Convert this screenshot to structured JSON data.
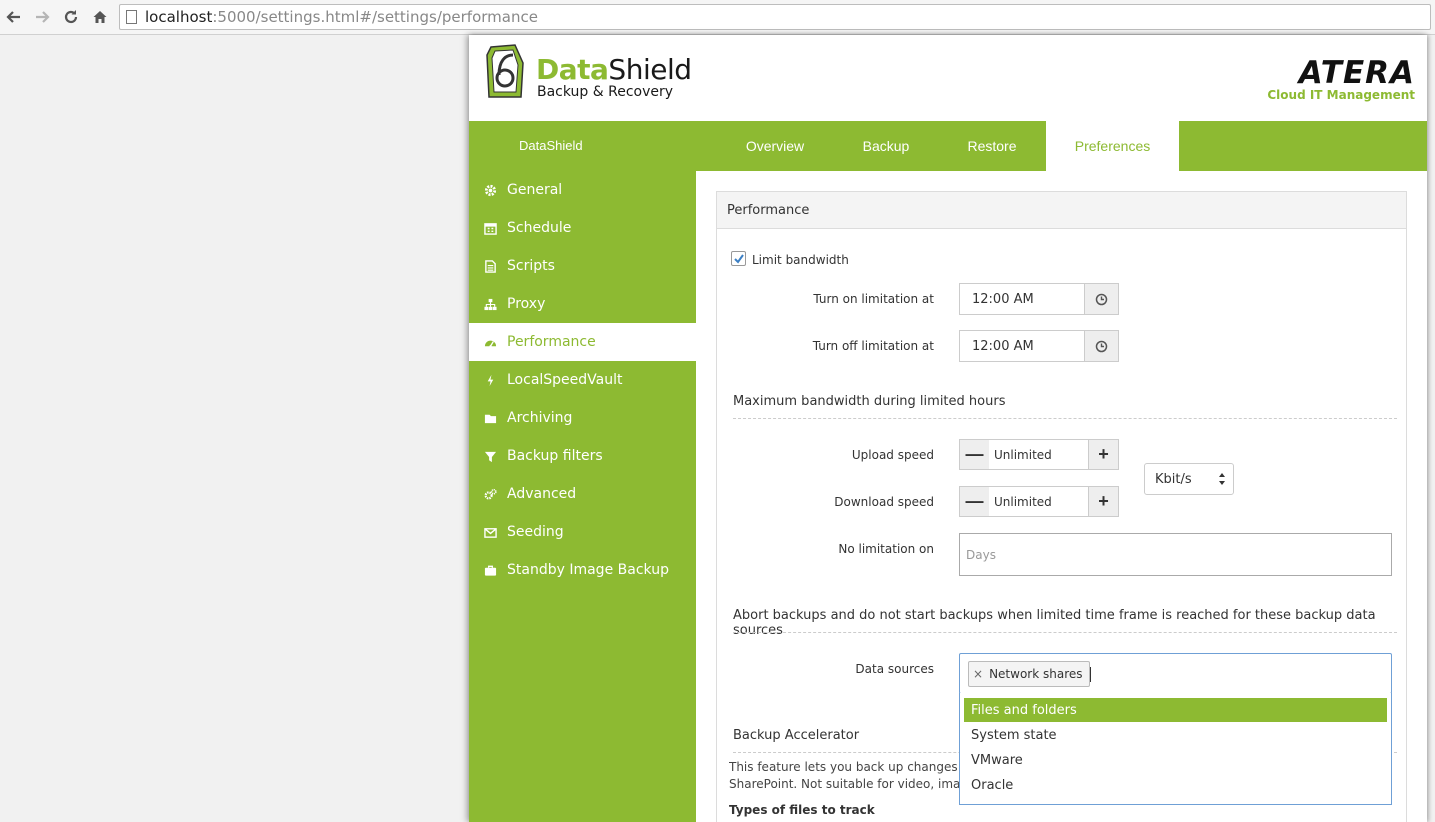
{
  "browser": {
    "url_host": "localhost",
    "url_path": ":5000/settings.html#/settings/performance"
  },
  "header": {
    "brand_green": "Data",
    "brand_dark": "Shield",
    "brand_sub": "Backup & Recovery",
    "partner_logo": "ATERA",
    "partner_sub": "Cloud IT Management"
  },
  "top_nav": {
    "brand": "DataShield",
    "tabs": [
      {
        "label": "Overview"
      },
      {
        "label": "Backup"
      },
      {
        "label": "Restore"
      },
      {
        "label": "Preferences"
      }
    ],
    "active_tab": "Preferences"
  },
  "sidebar": {
    "items": [
      {
        "label": "General",
        "icon": "gear-icon"
      },
      {
        "label": "Schedule",
        "icon": "calendar-icon"
      },
      {
        "label": "Scripts",
        "icon": "document-icon"
      },
      {
        "label": "Proxy",
        "icon": "sitemap-icon"
      },
      {
        "label": "Performance",
        "icon": "dashboard-icon"
      },
      {
        "label": "LocalSpeedVault",
        "icon": "bolt-icon"
      },
      {
        "label": "Archiving",
        "icon": "folder-icon"
      },
      {
        "label": "Backup filters",
        "icon": "filter-icon"
      },
      {
        "label": "Advanced",
        "icon": "gears-icon"
      },
      {
        "label": "Seeding",
        "icon": "envelope-icon"
      },
      {
        "label": "Standby Image Backup",
        "icon": "briefcase-icon"
      }
    ],
    "active": "Performance"
  },
  "panel": {
    "title": "Performance",
    "limit_bandwidth": {
      "label": "Limit bandwidth",
      "checked": true
    },
    "turn_on": {
      "label": "Turn on limitation at",
      "value": "12:00 AM"
    },
    "turn_off": {
      "label": "Turn off limitation at",
      "value": "12:00 AM"
    },
    "max_bandwidth_title": "Maximum bandwidth during limited hours",
    "upload": {
      "label": "Upload speed",
      "value": "Unlimited"
    },
    "download": {
      "label": "Download speed",
      "value": "Unlimited"
    },
    "unit": {
      "selected": "Kbit/s"
    },
    "no_limitation": {
      "label": "No limitation on",
      "placeholder": "Days"
    },
    "abort_title": "Abort backups and do not start backups when limited time frame is reached for these backup data sources",
    "data_sources": {
      "label": "Data sources",
      "selected_tags": [
        "Network shares"
      ],
      "options": [
        "Files and folders",
        "System state",
        "VMware",
        "Oracle"
      ],
      "highlighted": "Files and folders"
    },
    "accelerator_title": "Backup Accelerator",
    "accelerator_text_1": "This feature lets you back up changes wit",
    "accelerator_text_2": "SharePoint. Not suitable for video, image",
    "types_title": "Types of files to track"
  },
  "colors": {
    "brand_green": "#8dba32",
    "focus_blue": "#6fa0d6"
  }
}
